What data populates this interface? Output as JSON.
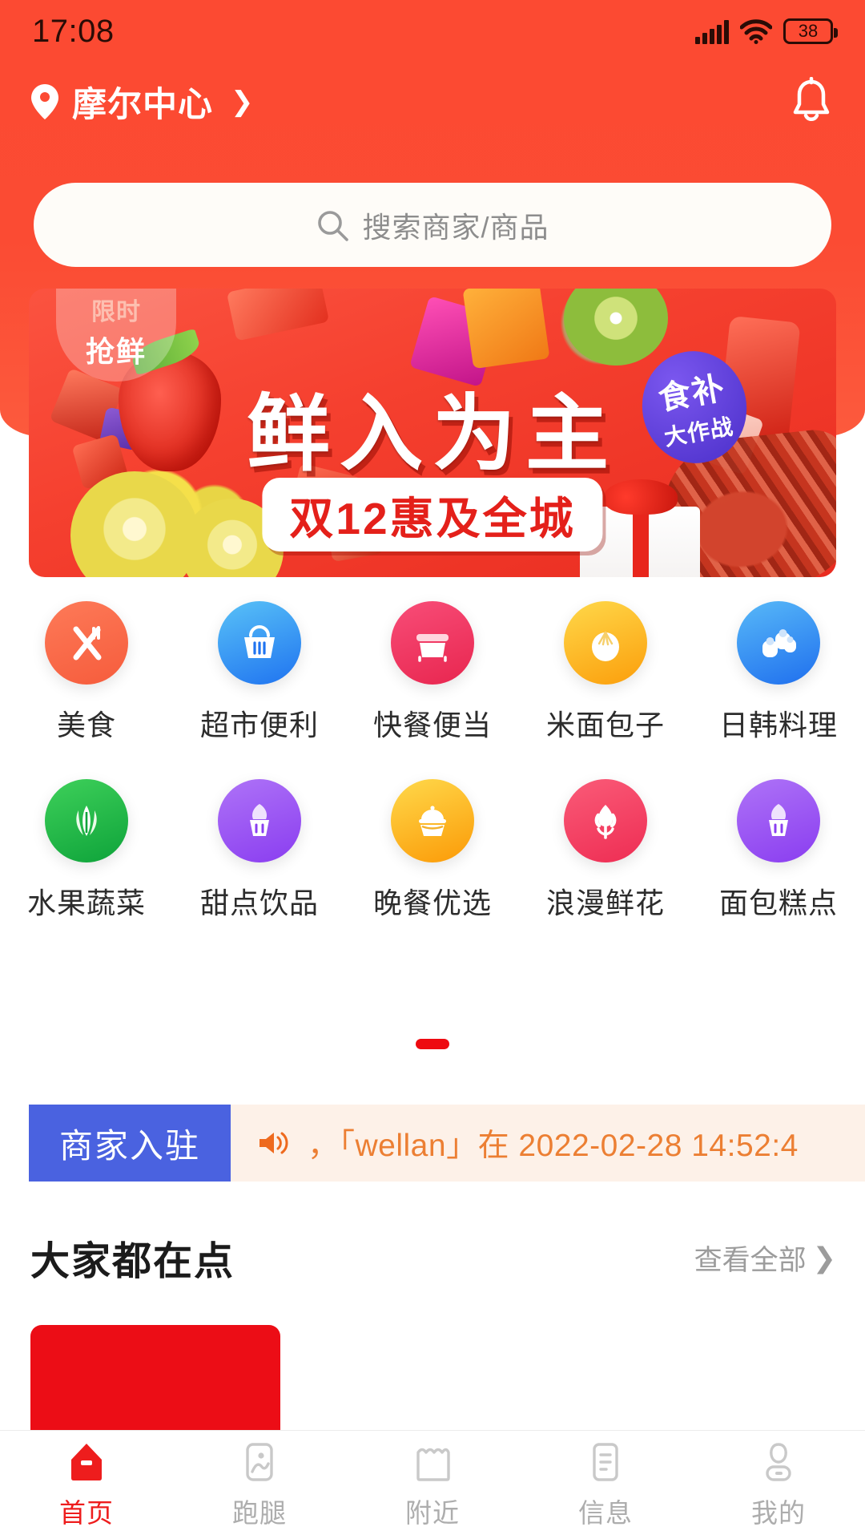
{
  "status_bar": {
    "time": "17:08",
    "battery_level": "38",
    "signal_icon": "signal-bars-icon",
    "wifi_icon": "wifi-icon",
    "battery_icon": "battery-icon"
  },
  "header": {
    "location_icon": "location-pin-icon",
    "location_name": "摩尔中心",
    "location_arrow": "❯",
    "bell_icon": "bell-icon",
    "bg_color": "#fc4a32"
  },
  "search": {
    "placeholder": "搜索商家/商品",
    "icon": "search-icon"
  },
  "banner": {
    "corner_tag_small": "限时",
    "corner_tag_big": "抢鲜",
    "title": "鲜入为主",
    "subtitle": "双12惠及全城",
    "badge_top": "食补",
    "badge_bottom": "大作战"
  },
  "categories": {
    "rows": [
      [
        {
          "label": "美食",
          "icon": "cutlery-icon",
          "color_a": "#fd7a58",
          "color_b": "#f65c3c"
        },
        {
          "label": "超市便利",
          "icon": "shopping-basket-icon",
          "color_a": "#59c2f7",
          "color_b": "#1f73f0"
        },
        {
          "label": "快餐便当",
          "icon": "lunchbox-icon",
          "color_a": "#f84d78",
          "color_b": "#e8264f"
        },
        {
          "label": "米面包子",
          "icon": "steamed-bun-icon",
          "color_a": "#ffd84a",
          "color_b": "#fb9e0b"
        },
        {
          "label": "日韩料理",
          "icon": "sushi-icon",
          "color_a": "#58b9f8",
          "color_b": "#1f6fee"
        }
      ],
      [
        {
          "label": "水果蔬菜",
          "icon": "vegetable-icon",
          "color_a": "#3ed05a",
          "color_b": "#0ea33a"
        },
        {
          "label": "甜点饮品",
          "icon": "cupcake-icon",
          "color_a": "#ae73f7",
          "color_b": "#8a3df0"
        },
        {
          "label": "晚餐优选",
          "icon": "stew-pot-icon",
          "color_a": "#ffd94b",
          "color_b": "#fb9a07"
        },
        {
          "label": "浪漫鲜花",
          "icon": "tulip-icon",
          "color_a": "#fa5b78",
          "color_b": "#ee2d53"
        },
        {
          "label": "面包糕点",
          "icon": "cupcake-icon",
          "color_a": "#ae73f7",
          "color_b": "#8a3df0"
        }
      ]
    ],
    "pager_color": "#ee0a10",
    "pager_pages": "1"
  },
  "notice": {
    "button_label": "商家入驻",
    "speaker_icon": "speaker-icon",
    "text": "，「wellan」在 2022-02-28 14:52:4",
    "text_color": "#ec7f33",
    "button_color": "#4a62e0"
  },
  "section": {
    "title": "大家都在点",
    "more_label": "查看全部",
    "more_arrow": "❯"
  },
  "tabbar": {
    "items": [
      {
        "label": "首页",
        "icon": "home-icon",
        "active": true
      },
      {
        "label": "跑腿",
        "icon": "errand-runner-icon",
        "active": false
      },
      {
        "label": "附近",
        "icon": "storefront-icon",
        "active": false
      },
      {
        "label": "信息",
        "icon": "message-list-icon",
        "active": false
      },
      {
        "label": "我的",
        "icon": "user-profile-icon",
        "active": false
      }
    ],
    "active_color": "#ee1d1d",
    "inactive_color": "#adadad"
  }
}
